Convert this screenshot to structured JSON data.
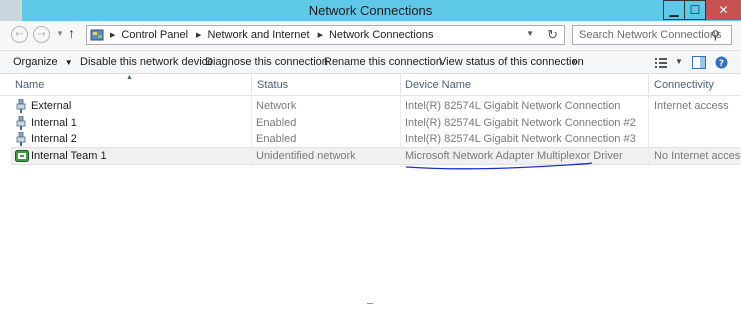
{
  "window": {
    "title": "Network Connections"
  },
  "address": {
    "crumbs": [
      "Control Panel",
      "Network and Internet",
      "Network Connections"
    ],
    "search_placeholder": "Search Network Connections"
  },
  "toolbar": {
    "organize": "Organize",
    "disable": "Disable this network device",
    "diagnose": "Diagnose this connection",
    "rename": "Rename this connection",
    "view_status": "View status of this connection",
    "more": "»"
  },
  "columns": {
    "name": "Name",
    "status": "Status",
    "device": "Device Name",
    "connectivity": "Connectivity"
  },
  "rows": [
    {
      "name": "External",
      "status": "Network",
      "device": "Intel(R) 82574L Gigabit Network Connection",
      "connectivity": "Internet access"
    },
    {
      "name": "Internal 1",
      "status": "Enabled",
      "device": "Intel(R) 82574L Gigabit Network Connection #2",
      "connectivity": ""
    },
    {
      "name": "Internal 2",
      "status": "Enabled",
      "device": "Intel(R) 82574L Gigabit Network Connection #3",
      "connectivity": ""
    },
    {
      "name": "Internal Team 1",
      "status": "Unidentified network",
      "device": "Microsoft Network Adapter Multiplexor Driver",
      "connectivity": "No Internet access"
    }
  ],
  "colors": {
    "titlebar": "#5ec8e8",
    "annotation": "#1a2fd6",
    "header_text": "#4c607a"
  }
}
